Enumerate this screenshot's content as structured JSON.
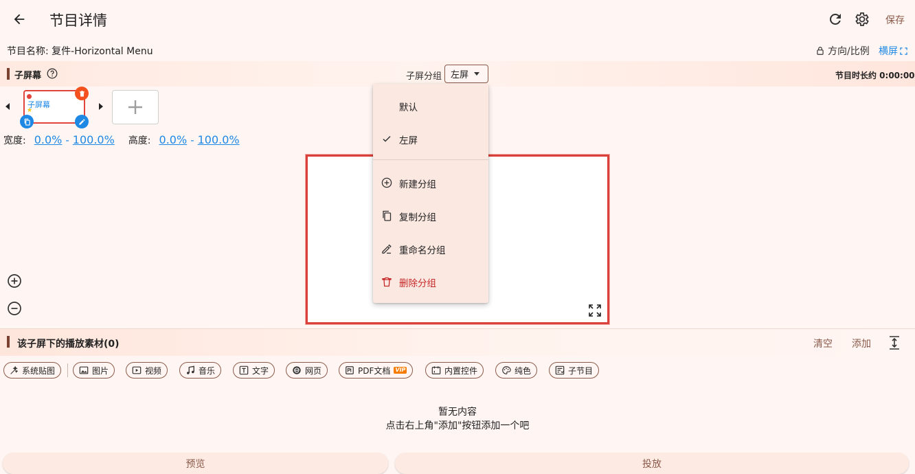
{
  "header": {
    "title": "节目详情",
    "save_label": "保存"
  },
  "program": {
    "name_label": "节目名称: 复件-Horizontal Menu",
    "orientation_label": "方向/比例",
    "landscape_label": "横屏"
  },
  "subscreen": {
    "title": "子屏幕",
    "group_label": "子屏分组",
    "group_value": "左屏",
    "duration": "节目时长约 0:00:00",
    "thumbnail_label": "子屏幕",
    "width_label": "宽度:",
    "width_from": "0.0%",
    "width_to": "100.0%",
    "height_label": "高度:",
    "height_from": "0.0%",
    "height_to": "100.0%",
    "range_separator": "-"
  },
  "group_menu": {
    "items": [
      {
        "label": "默认",
        "icon": "none",
        "checked": false
      },
      {
        "label": "左屏",
        "icon": "check-icon",
        "checked": true
      },
      {
        "label": "新建分组",
        "icon": "add-circle-icon"
      },
      {
        "label": "复制分组",
        "icon": "copy-icon"
      },
      {
        "label": "重命名分组",
        "icon": "rename-icon"
      },
      {
        "label": "删除分组",
        "icon": "trash-icon",
        "color": "#c62828"
      }
    ]
  },
  "materials": {
    "title": "该子屏下的播放素材(0)",
    "clear_label": "清空",
    "add_label": "添加",
    "chips": [
      {
        "label": "系统贴图",
        "icon": "sticker-icon"
      },
      {
        "label": "图片",
        "icon": "image-icon"
      },
      {
        "label": "视频",
        "icon": "video-icon"
      },
      {
        "label": "音乐",
        "icon": "music-icon"
      },
      {
        "label": "文字",
        "icon": "text-icon"
      },
      {
        "label": "网页",
        "icon": "web-icon"
      },
      {
        "label": "PDF文档",
        "icon": "pdf-icon",
        "badge": "VIP"
      },
      {
        "label": "内置控件",
        "icon": "widget-icon"
      },
      {
        "label": "纯色",
        "icon": "palette-icon"
      },
      {
        "label": "子节目",
        "icon": "subprogram-icon"
      }
    ],
    "empty_title": "暂无内容",
    "empty_hint": "点击右上角\"添加\"按钮添加一个吧"
  },
  "footer": {
    "preview_label": "预览",
    "cast_label": "投放"
  },
  "colors": {
    "accent_blue": "#1e88e5",
    "alert_red": "#d9413a",
    "brand_brown": "#8a5a4a",
    "background": "#fff5f2"
  }
}
